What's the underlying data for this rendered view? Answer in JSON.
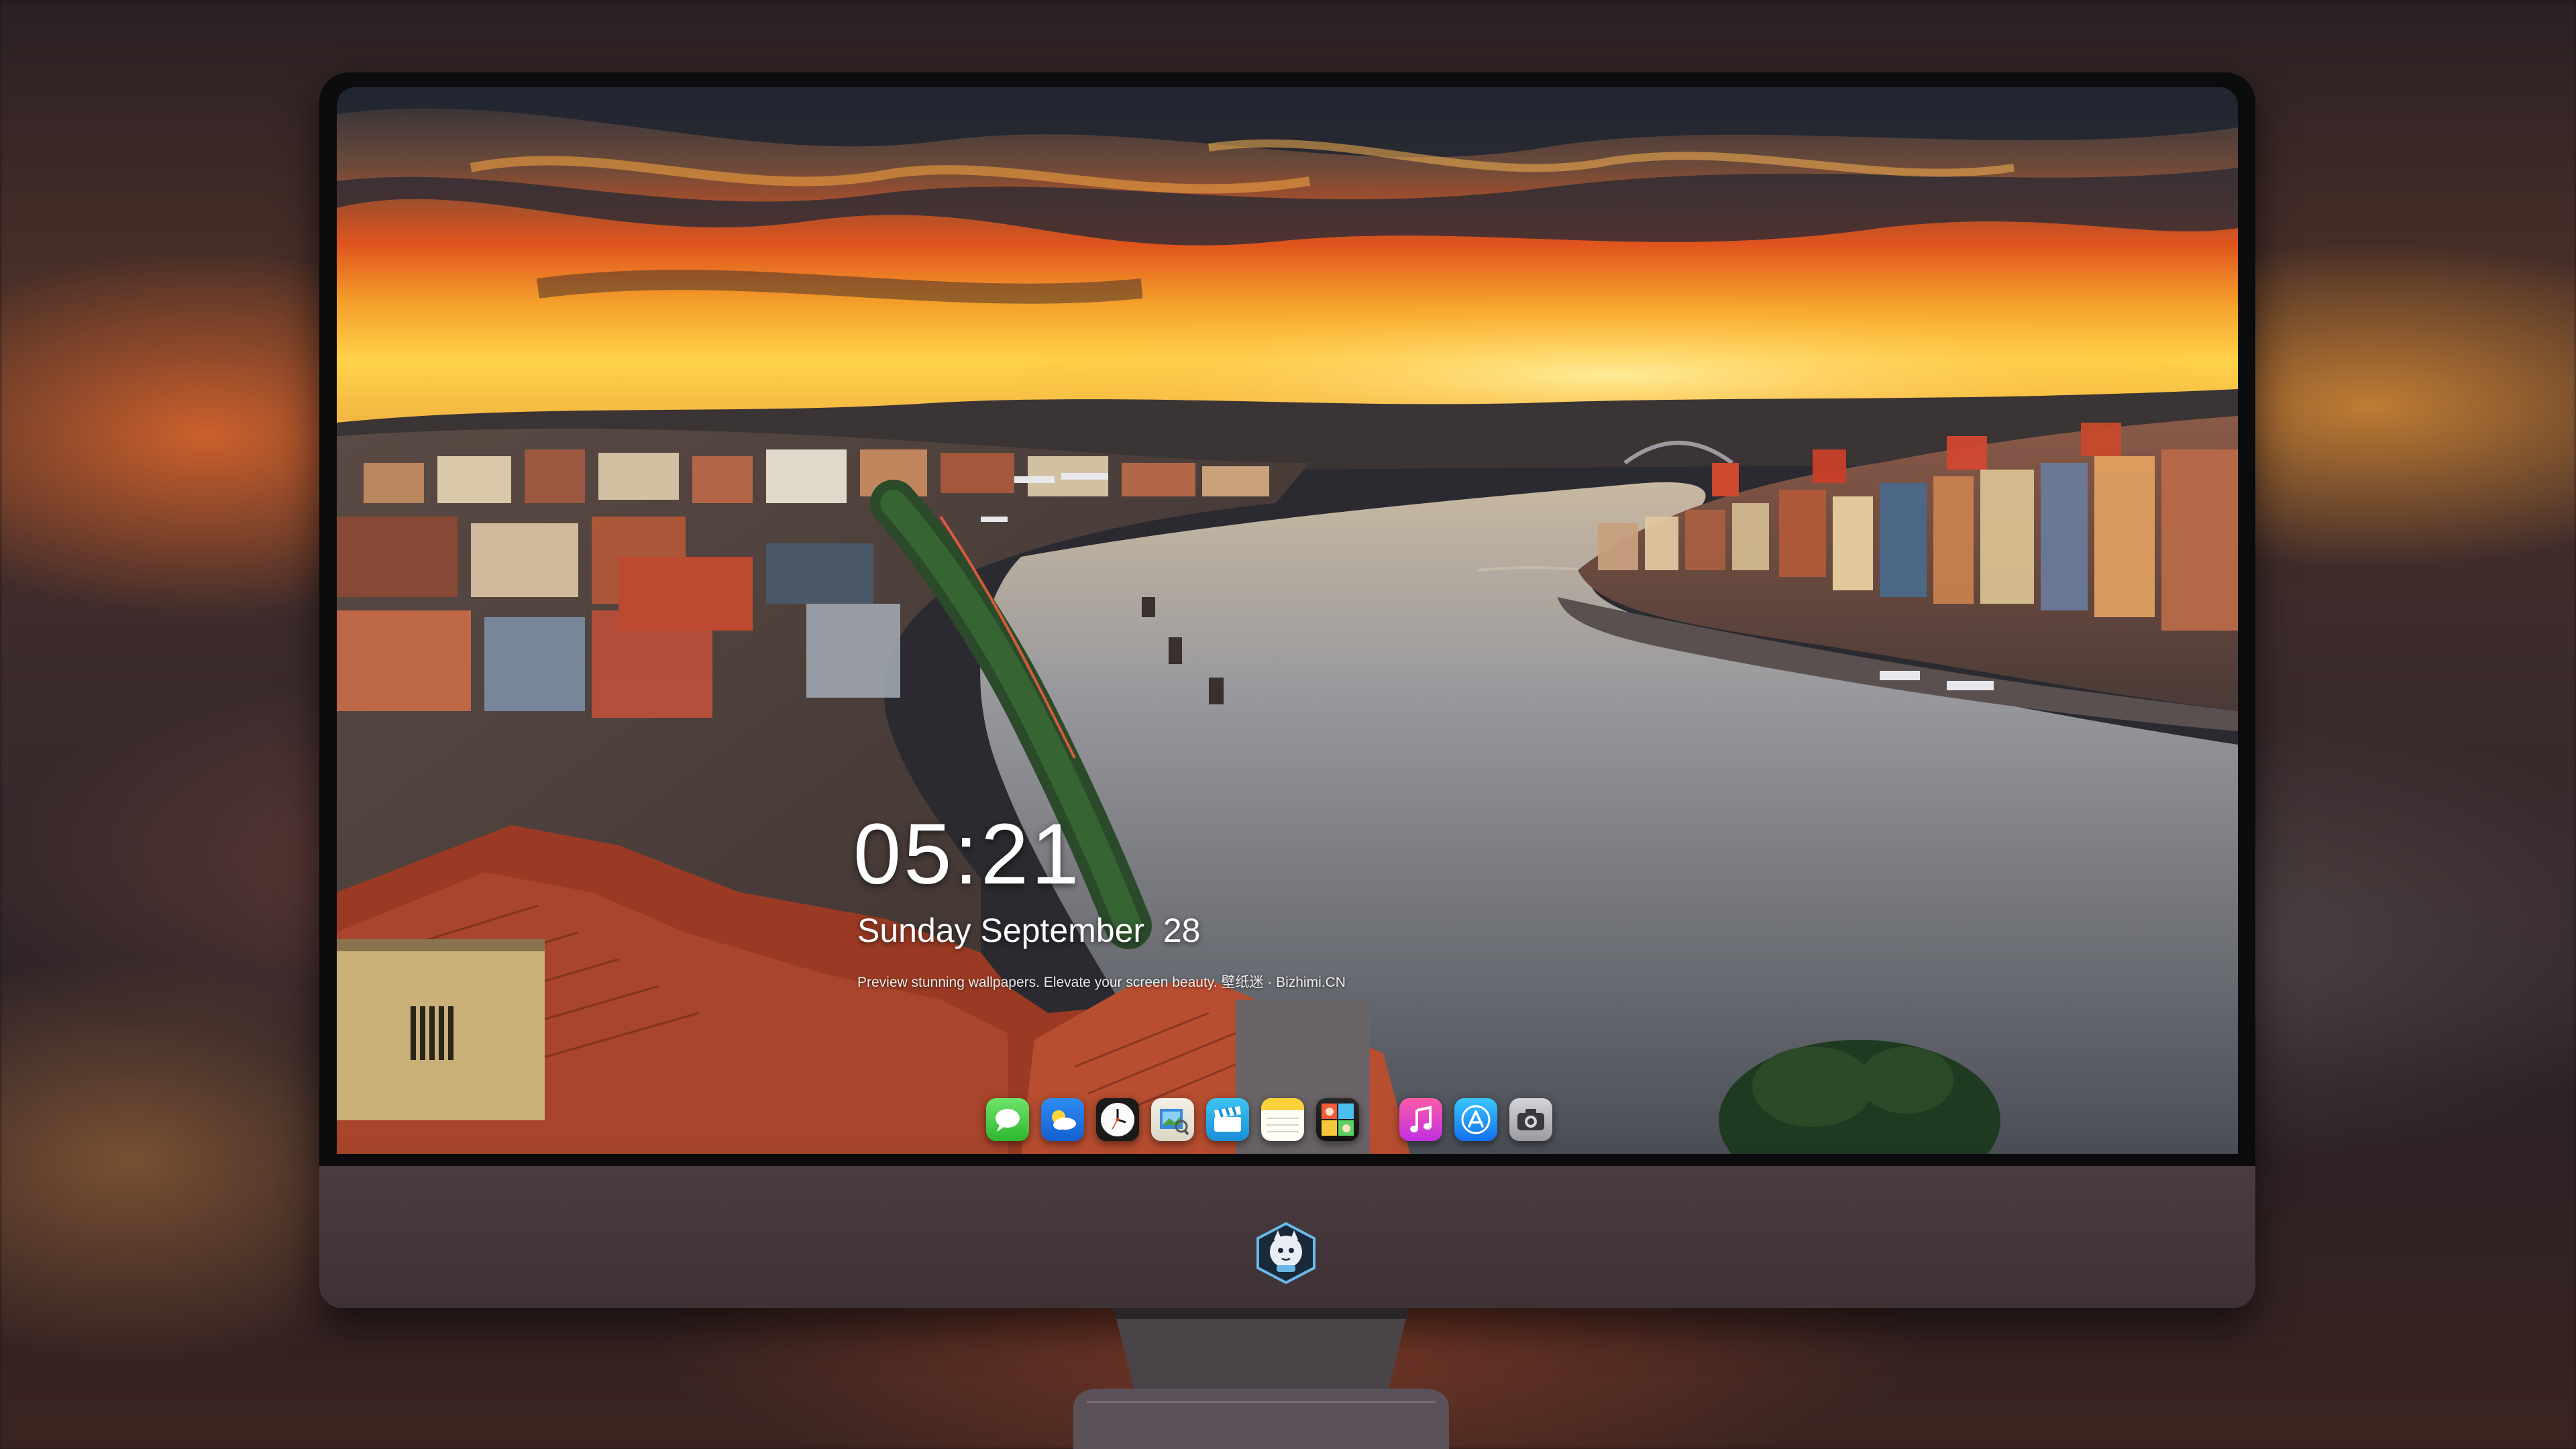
{
  "lock_screen": {
    "time": "05:21",
    "date": "Sunday September  28",
    "tagline": "Preview stunning wallpapers. Elevate your screen beauty. 壁纸迷 · Bizhimi.CN"
  },
  "dock": {
    "items": [
      {
        "icon": "messages-icon",
        "label": "Messages"
      },
      {
        "icon": "weather-icon",
        "label": "Weather"
      },
      {
        "icon": "clock-icon",
        "label": "Clock"
      },
      {
        "icon": "preview-icon",
        "label": "Preview"
      },
      {
        "icon": "clips-icon",
        "label": "Clips"
      },
      {
        "icon": "notes-icon",
        "label": "Notes"
      },
      {
        "icon": "photo-booth-icon",
        "label": "Photo Booth"
      },
      {
        "icon": "music-icon",
        "label": "Music"
      },
      {
        "icon": "app-store-icon",
        "label": "App Store"
      },
      {
        "icon": "camera-icon",
        "label": "Camera"
      }
    ]
  },
  "colors": {
    "sky_orange": "#f08a24",
    "sky_yellow": "#ffc93a",
    "river": "#8a8c92",
    "roof_red": "#b84a2e",
    "chin": "#443a3e"
  }
}
